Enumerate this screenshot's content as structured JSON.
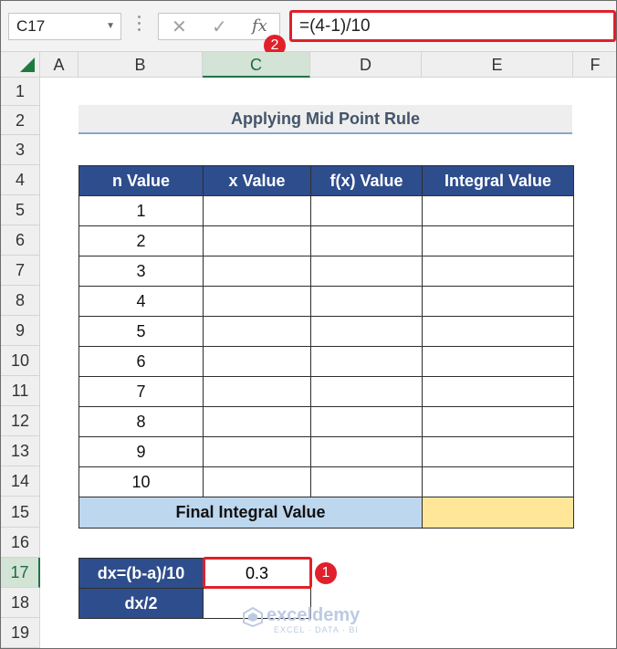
{
  "name_box": "C17",
  "formula": "=(4-1)/10",
  "icons": {
    "cancel": "✕",
    "enter": "✓",
    "fx": "fx"
  },
  "badges": {
    "formula": "2",
    "cell": "1"
  },
  "columns": [
    "A",
    "B",
    "C",
    "D",
    "E",
    "F"
  ],
  "rows": [
    "1",
    "2",
    "3",
    "4",
    "5",
    "6",
    "7",
    "8",
    "9",
    "10",
    "11",
    "12",
    "13",
    "14",
    "15",
    "16",
    "17",
    "18",
    "19"
  ],
  "selected": {
    "column": "C",
    "row": "17"
  },
  "title": "Applying Mid Point Rule",
  "table": {
    "headers": [
      "n Value",
      "x Value",
      "f(x) Value",
      "Integral Value"
    ],
    "n_values": [
      "1",
      "2",
      "3",
      "4",
      "5",
      "6",
      "7",
      "8",
      "9",
      "10"
    ],
    "final_label": "Final Integral Value"
  },
  "dx": {
    "row1_label": "dx=(b-a)/10",
    "row1_value": "0.3",
    "row2_label": "dx/2",
    "row2_value": ""
  },
  "watermark": {
    "name": "exceldemy",
    "tagline": "EXCEL · DATA · BI"
  },
  "colors": {
    "header_blue": "#2e4d8c",
    "final_label": "#bdd7ee",
    "final_value": "#ffe699",
    "highlight_red": "#e0202a",
    "excel_green": "#217346"
  }
}
